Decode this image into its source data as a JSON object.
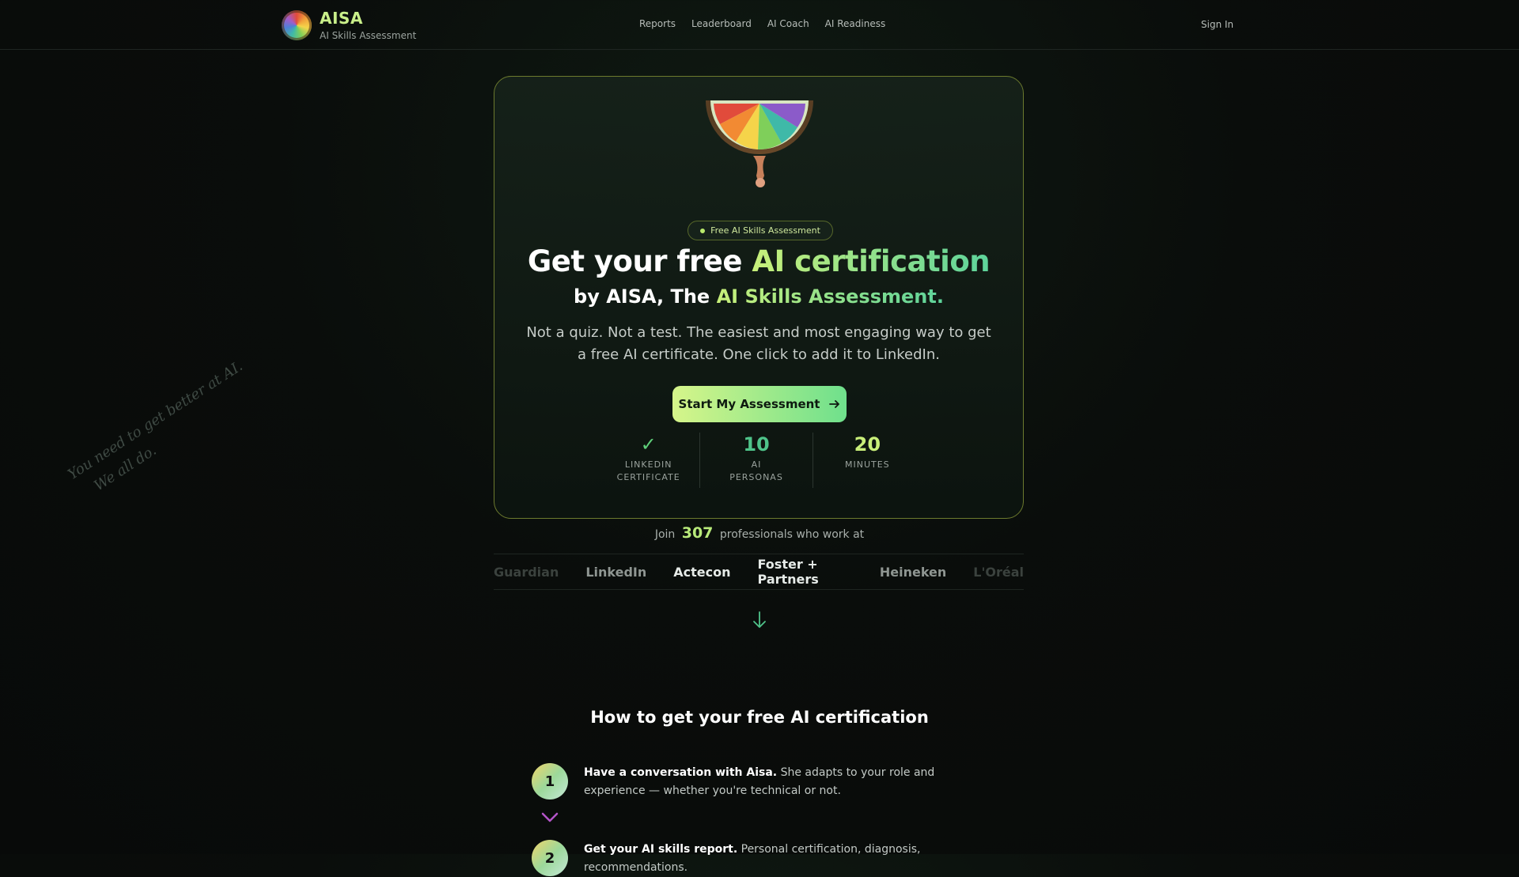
{
  "header": {
    "brand_name": "AISA",
    "brand_sub": "AI Skills Assessment",
    "nav": [
      "Reports",
      "Leaderboard",
      "AI Coach",
      "AI Readiness"
    ],
    "signin": "Sign In"
  },
  "hero": {
    "badge": "Free AI Skills Assessment",
    "title_plain": "Get your free ",
    "title_accent": "AI certification",
    "sub_plain": "by AISA, The ",
    "sub_accent": "AI Skills Assessment.",
    "description": "Not a quiz. Not a test. The easiest and most engaging way to get a free AI certificate. One click to add it to LinkedIn.",
    "cta_label": "Start My Assessment",
    "stats": [
      {
        "value": "✓",
        "label": "LinkedIn Certificate",
        "color": "#5fd07a"
      },
      {
        "value": "10",
        "label": "AI Personas",
        "color": "#4fc48a"
      },
      {
        "value": "20",
        "label": "Minutes",
        "color": "#c9ef7a"
      }
    ]
  },
  "social_proof": {
    "prefix": "Join",
    "count": "307",
    "suffix": "professionals who work at",
    "companies": [
      "Guardian",
      "LinkedIn",
      "Actecon",
      "Foster + Partners",
      "Heineken",
      "L'Oréal"
    ]
  },
  "handwritten": {
    "line1": "You need to get better at AI.",
    "line2": "We all do."
  },
  "how": {
    "title": "How to get your free AI certification",
    "steps": [
      {
        "num": "1",
        "bold": "Have a conversation with Aisa.",
        "text": " She adapts to your role and experience — whether you're technical or not."
      },
      {
        "num": "2",
        "bold": "Get your AI skills report.",
        "text": " Personal certification, diagnosis, recommendations."
      }
    ]
  }
}
